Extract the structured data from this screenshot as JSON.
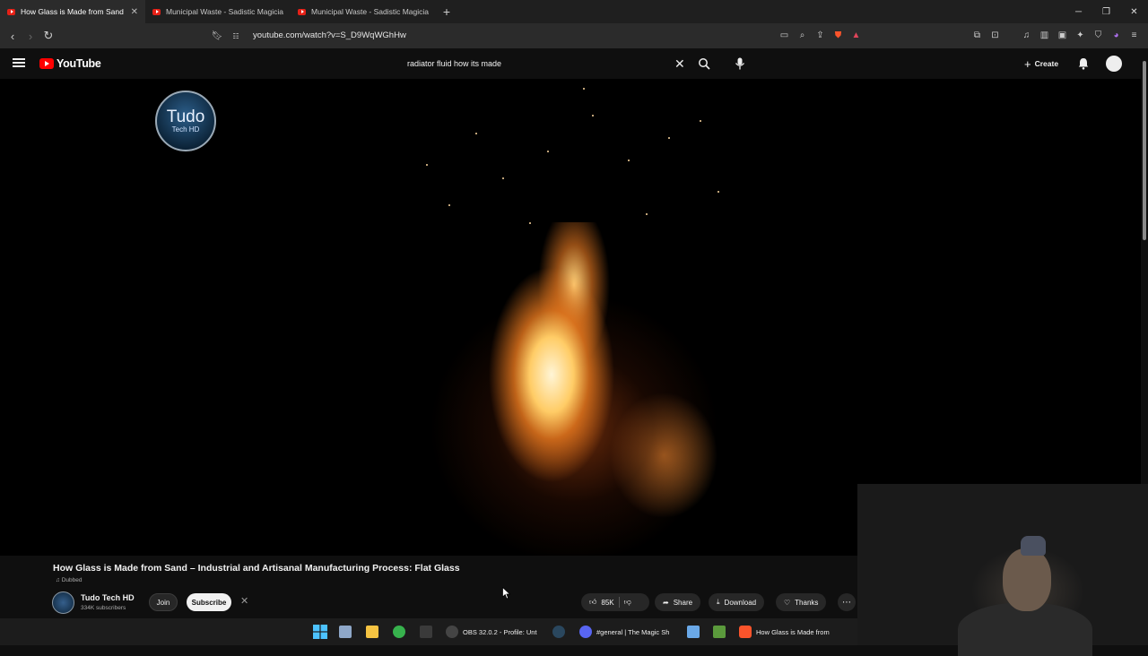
{
  "browser": {
    "tabs": [
      {
        "label": "How Glass is Made from Sand",
        "active": true
      },
      {
        "label": "Municipal Waste - Sadistic Magician",
        "active": false
      },
      {
        "label": "Municipal Waste - Sadistic Magician",
        "active": false
      }
    ],
    "url": "youtube.com/watch?v=S_D9WqWGhHw"
  },
  "youtube": {
    "logo_text": "YouTube",
    "search_query": "radiator fluid how its made",
    "create_label": "Create"
  },
  "player": {
    "watermark_line1": "Tudo",
    "watermark_line2": "Tech HD"
  },
  "video": {
    "title": "How Glass is Made from Sand – Industrial and Artisanal Manufacturing Process: Flat Glass",
    "dubbed_label": "Dubbed",
    "channel_name": "Tudo Tech HD",
    "subscribers": "334K subscribers",
    "join_label": "Join",
    "subscribe_label": "Subscribe",
    "likes": "85K",
    "share_label": "Share",
    "download_label": "Download",
    "thanks_label": "Thanks"
  },
  "taskbar": {
    "obs_label": "OBS 32.0.2 - Profile: Unt",
    "discord_label": "#general | The Magic Sh",
    "browser_label": "How Glass is Made from"
  },
  "colors": {
    "youtube_red": "#ff0000",
    "background": "#0f0f0f",
    "pill_bg": "#272727"
  }
}
